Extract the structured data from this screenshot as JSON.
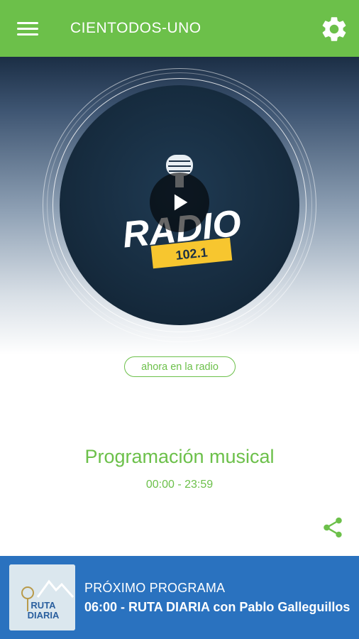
{
  "appbar": {
    "title": "CIENTODOS-UNO",
    "menu_icon": "hamburger-menu-icon",
    "settings_icon": "gear-icon",
    "color": "#6cc04a"
  },
  "player": {
    "logo_text": "RADIO",
    "logo_frequency": "102.1",
    "play_icon": "play-icon",
    "badge": "ahora en la radio"
  },
  "current_program": {
    "title": "Programación musical",
    "time": "00:00 - 23:59",
    "share_icon": "share-icon"
  },
  "next_program": {
    "label": "PRÓXIMO PROGRAMA",
    "show": "06:00 - RUTA DIARIA con Pablo Galleguillos",
    "thumb_text_1": "RUTA",
    "thumb_text_2": "DIARIA",
    "color": "#2a72bf"
  }
}
